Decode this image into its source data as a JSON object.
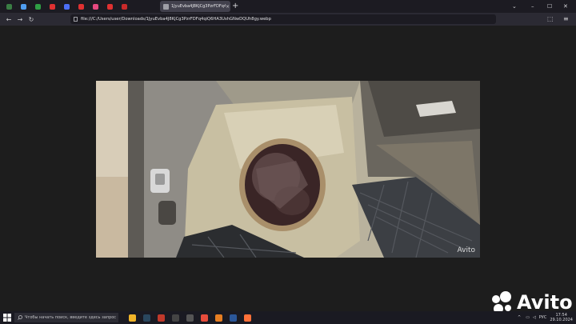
{
  "browser": {
    "tab_title": "1JyuEvba4J8Kj­Cg3PzrFDFq4qiQ6HA3UshGNwDQUh8gy.webp",
    "url": "file:///C:/Users/user/Downloads/1JyuEvba4J8KjCg3PzrFDFq4qiQ6HA3UshGNwDQUh8gy.webp",
    "tab_close": "×",
    "new_tab": "+",
    "back": "←",
    "forward": "→",
    "reload": "↻",
    "win_min": "–",
    "win_max": "☐",
    "win_close": "✕",
    "pinned_tabs": [
      {
        "icon": "app-icon",
        "color": "#3a7d44"
      },
      {
        "icon": "app-icon",
        "color": "#4f9df0"
      },
      {
        "icon": "app-icon",
        "color": "#2f9e44"
      },
      {
        "icon": "app-icon",
        "color": "#e03131"
      },
      {
        "icon": "app-icon",
        "color": "#4c6ef5"
      },
      {
        "icon": "app-icon",
        "color": "#e03131"
      },
      {
        "icon": "app-icon",
        "color": "#e64980"
      },
      {
        "icon": "app-icon",
        "color": "#e03131"
      },
      {
        "icon": "app-icon",
        "color": "#c92a2a"
      }
    ]
  },
  "image": {
    "watermark": "Avito"
  },
  "overlay": {
    "logo_text": "Avito"
  },
  "taskbar": {
    "search_placeholder": "Чтобы начать поиск, введите здесь запрос",
    "language": "РУС",
    "time": "17:54",
    "date": "29.10.2024",
    "apps": [
      {
        "name": "file-explorer",
        "color": "#f0b429"
      },
      {
        "name": "steam",
        "color": "#2a475e"
      },
      {
        "name": "app",
        "color": "#c0392b"
      },
      {
        "name": "app",
        "color": "#444444"
      },
      {
        "name": "app",
        "color": "#555555"
      },
      {
        "name": "yandex",
        "color": "#e74c3c"
      },
      {
        "name": "app",
        "color": "#e67e22"
      },
      {
        "name": "word",
        "color": "#2b579a"
      },
      {
        "name": "firefox",
        "color": "#ff7139"
      }
    ]
  }
}
